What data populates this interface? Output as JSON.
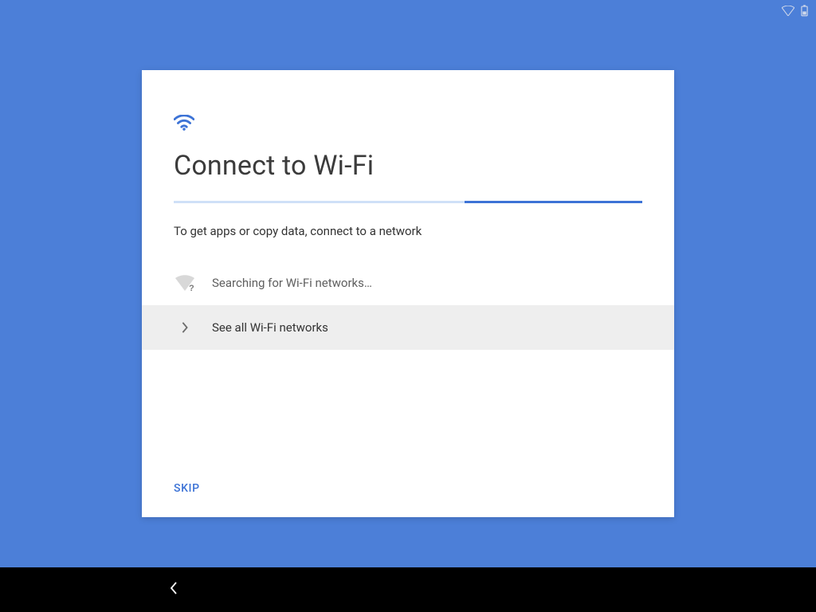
{
  "statusbar": {
    "wifi_icon": "wifi-outline",
    "battery_icon": "battery-outline"
  },
  "header": {
    "icon": "wifi",
    "title": "Connect to Wi-Fi",
    "subtitle": "To get apps or copy data, connect to a network",
    "progress": {
      "start_pct": 62,
      "end_pct": 100
    }
  },
  "rows": {
    "searching": {
      "icon": "wifi-unknown",
      "label": "Searching for Wi-Fi networks…"
    },
    "see_all": {
      "icon": "chevron-right",
      "label": "See all Wi-Fi networks"
    }
  },
  "footer": {
    "skip_label": "SKIP"
  },
  "navbar": {
    "back_icon": "chevron-left"
  },
  "colors": {
    "accent": "#3d73d6",
    "bg": "#4c7fd8"
  }
}
